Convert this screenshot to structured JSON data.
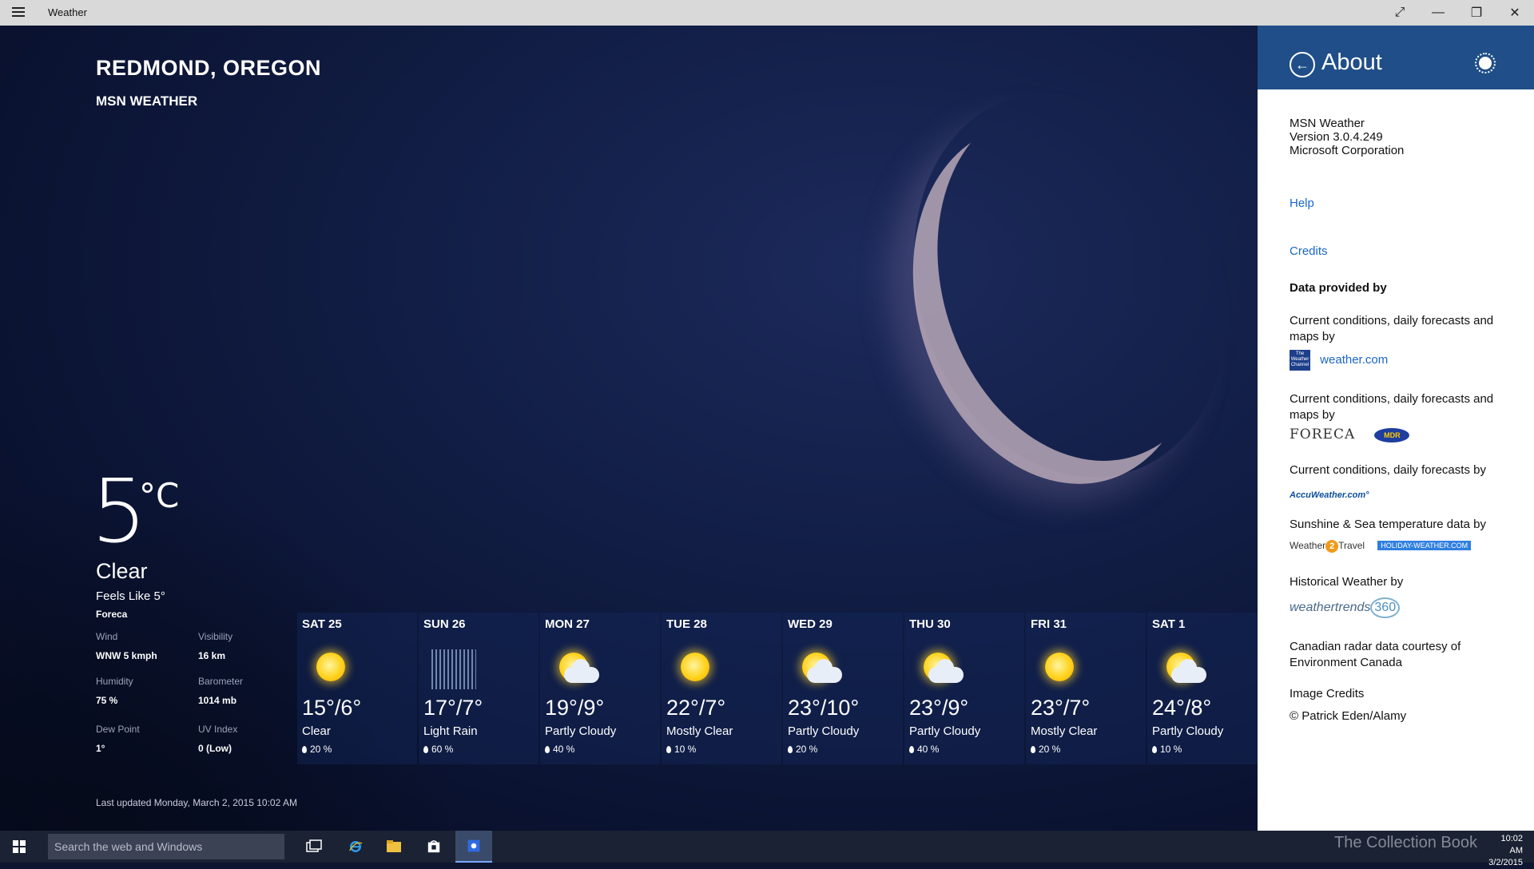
{
  "window": {
    "title": "Weather",
    "buttons": [
      "expand",
      "minimize",
      "restore",
      "close"
    ]
  },
  "location": "REDMOND, OREGON",
  "provider_title": "MSN WEATHER",
  "current": {
    "temp": "5",
    "unit": "°C",
    "condition": "Clear",
    "feels_like": "Feels Like 5°",
    "source": "Foreca",
    "details": [
      {
        "label": "Wind",
        "value": "WNW 5 kmph"
      },
      {
        "label": "Visibility",
        "value": "16 km"
      },
      {
        "label": "Humidity",
        "value": "75 %"
      },
      {
        "label": "Barometer",
        "value": "1014 mb"
      },
      {
        "label": "Dew Point",
        "value": "1°"
      },
      {
        "label": "UV Index",
        "value": "0 (Low)"
      }
    ],
    "last_updated": "Last updated Monday, March 2, 2015 10:02 AM"
  },
  "forecast": [
    {
      "day": "SAT 25",
      "hilo": "15°/6°",
      "cond": "Clear",
      "precip": "20 %",
      "icon": "sun-icon"
    },
    {
      "day": "SUN 26",
      "hilo": "17°/7°",
      "cond": "Light Rain",
      "precip": "60 %",
      "icon": "rain-icon"
    },
    {
      "day": "MON 27",
      "hilo": "19°/9°",
      "cond": "Partly Cloudy",
      "precip": "40 %",
      "icon": "partly-cloudy-icon"
    },
    {
      "day": "TUE 28",
      "hilo": "22°/7°",
      "cond": "Mostly Clear",
      "precip": "10 %",
      "icon": "sun-icon"
    },
    {
      "day": "WED 29",
      "hilo": "23°/10°",
      "cond": "Partly Cloudy",
      "precip": "20 %",
      "icon": "partly-cloudy-icon"
    },
    {
      "day": "THU 30",
      "hilo": "23°/9°",
      "cond": "Partly Cloudy",
      "precip": "40 %",
      "icon": "partly-cloudy-icon"
    },
    {
      "day": "FRI 31",
      "hilo": "23°/7°",
      "cond": "Mostly Clear",
      "precip": "20 %",
      "icon": "sun-icon"
    },
    {
      "day": "SAT 1",
      "hilo": "24°/8°",
      "cond": "Partly Cloudy",
      "precip": "10 %",
      "icon": "partly-cloudy-icon"
    }
  ],
  "about": {
    "title": "About",
    "app_name": "MSN Weather",
    "version": "Version 3.0.4.249",
    "company": "Microsoft Corporation",
    "help": "Help",
    "credits": "Credits",
    "data_provided_by": "Data provided by",
    "p1": "Current conditions, daily forecasts and maps by",
    "twc_logo": "The Weather Channel",
    "weather_com": "weather.com",
    "p2": "Current conditions, daily forecasts and maps by",
    "foreca_logo": "FORECA",
    "mdr_logo": "MDR",
    "p3": "Current conditions, daily forecasts by",
    "accu_logo": "AccuWeather.com°",
    "p4": "Sunshine & Sea temperature data by",
    "w2t_left": "Weather",
    "w2t_mid": "2",
    "w2t_right": "Travel",
    "holiday_logo": "HOLIDAY-WEATHER.COM",
    "p5": "Historical Weather by",
    "wt_logo": "weathertrends",
    "wt_num": "360",
    "p6": "Canadian radar data courtesy of Environment Canada",
    "image_credits": "Image Credits",
    "image_author": "© Patrick Eden/Alamy"
  },
  "taskbar": {
    "search_placeholder": "Search the web and Windows",
    "watermark": "The Collection Book",
    "time": "10:02 AM",
    "date": "3/2/2015"
  },
  "colors": {
    "panel_header": "#1f4e88",
    "link": "#1a66c8",
    "taskbar": "#1a2233"
  }
}
